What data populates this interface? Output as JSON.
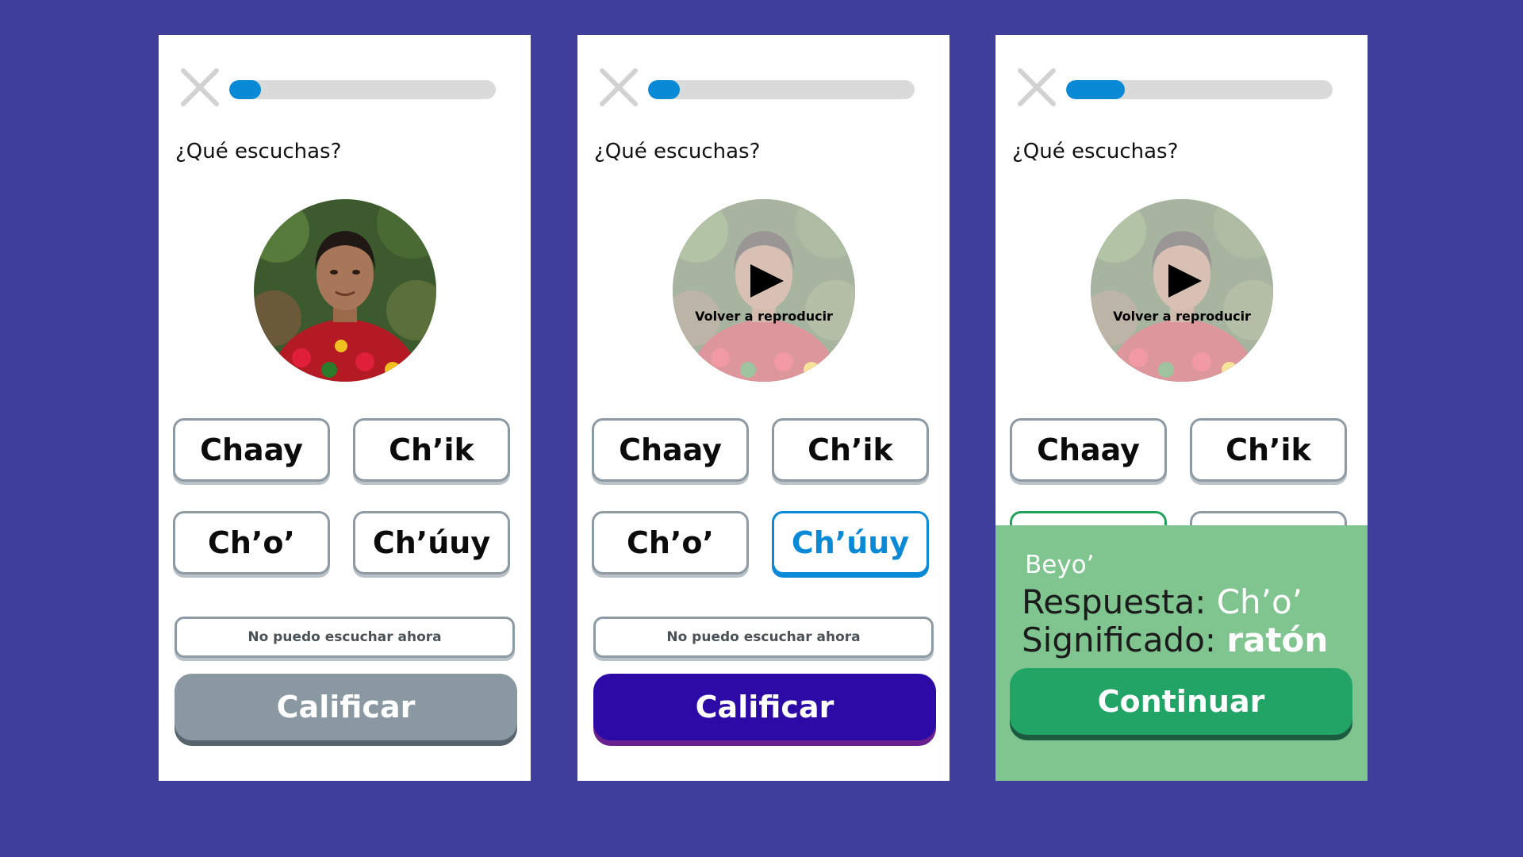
{
  "colors": {
    "background": "#3f3f9b",
    "progress_fill": "#0a8ad6",
    "selected_option": "#0a8ad6",
    "check_disabled": "#8a98a2",
    "check_active": "#2b0aa6",
    "result_background": "#80c590",
    "continue_button": "#22a466"
  },
  "panels": [
    {
      "progress": 0.12,
      "prompt": "¿Qué escuchas?",
      "speaker_state": "photo",
      "options": [
        "Chaay",
        "Ch’ik",
        "Ch’o’",
        "Ch’úuy"
      ],
      "selected_option": null,
      "cant_listen_label": "No puedo escuchar ahora",
      "check_label": "Calificar",
      "check_enabled": false
    },
    {
      "progress": 0.12,
      "prompt": "¿Qué escuchas?",
      "speaker_state": "replay",
      "replay_label": "Volver a reproducir",
      "options": [
        "Chaay",
        "Ch’ik",
        "Ch’o’",
        "Ch’úuy"
      ],
      "selected_option": "Ch’úuy",
      "cant_listen_label": "No puedo escuchar ahora",
      "check_label": "Calificar",
      "check_enabled": true
    },
    {
      "progress": 0.22,
      "prompt": "¿Qué escuchas?",
      "speaker_state": "replay",
      "replay_label": "Volver a reproducir",
      "options": [
        "Chaay",
        "Ch’ik"
      ],
      "result": {
        "heading": "Beyo’",
        "answer_label": "Respuesta: ",
        "answer_value": "Ch’o’",
        "meaning_label": "Significado: ",
        "meaning_value": "ratón",
        "continue_label": "Continuar"
      }
    }
  ]
}
